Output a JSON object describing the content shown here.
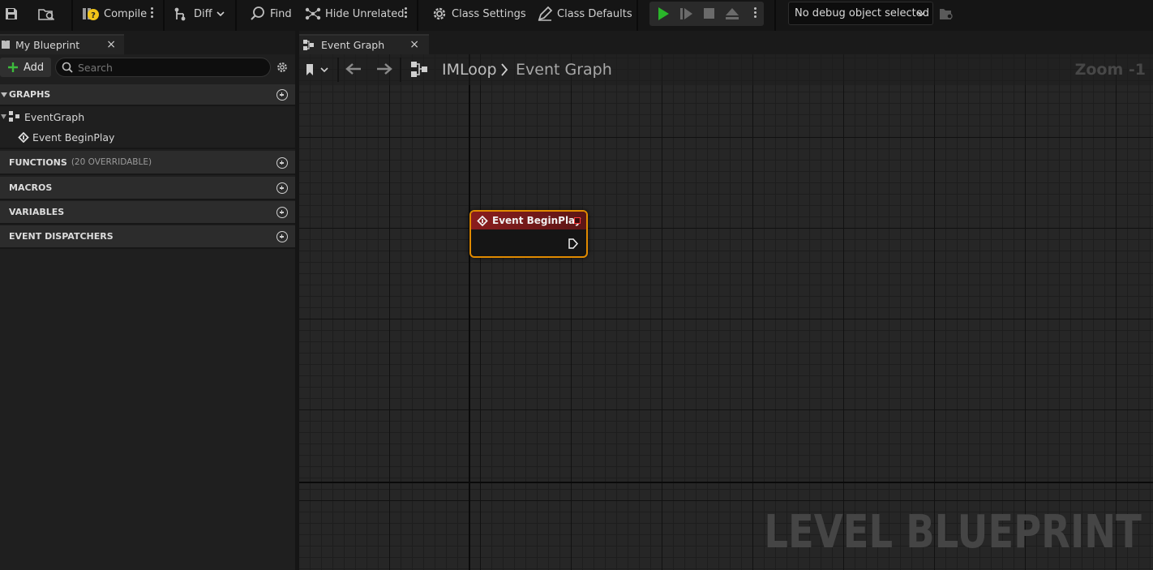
{
  "toolbar": {
    "compile_label": "Compile",
    "diff_label": "Diff",
    "find_label": "Find",
    "hide_unrelated_label": "Hide Unrelated",
    "class_settings_label": "Class Settings",
    "class_defaults_label": "Class Defaults",
    "debug_select_value": "No debug object selected",
    "play_color": "#2ab52a"
  },
  "tabs": {
    "my_blueprint": "My Blueprint",
    "event_graph": "Event Graph",
    "close_glyph": "×"
  },
  "sidebar": {
    "add_label": "Add",
    "search_placeholder": "Search",
    "graphs_label": "GRAPHS",
    "graph_items": [
      {
        "label": "EventGraph"
      },
      {
        "label": "Event BeginPlay"
      }
    ],
    "functions_label": "FUNCTIONS",
    "functions_note": "(20 OVERRIDABLE)",
    "macros_label": "MACROS",
    "variables_label": "VARIABLES",
    "dispatchers_label": "EVENT DISPATCHERS"
  },
  "graph": {
    "breadcrumb_root": "IMLoop",
    "breadcrumb_current": "Event Graph",
    "zoom_label": "Zoom -1",
    "node_title": "Event BeginPlay",
    "node_accent": "#e08a00",
    "watermark": "LEVEL BLUEPRINT"
  }
}
